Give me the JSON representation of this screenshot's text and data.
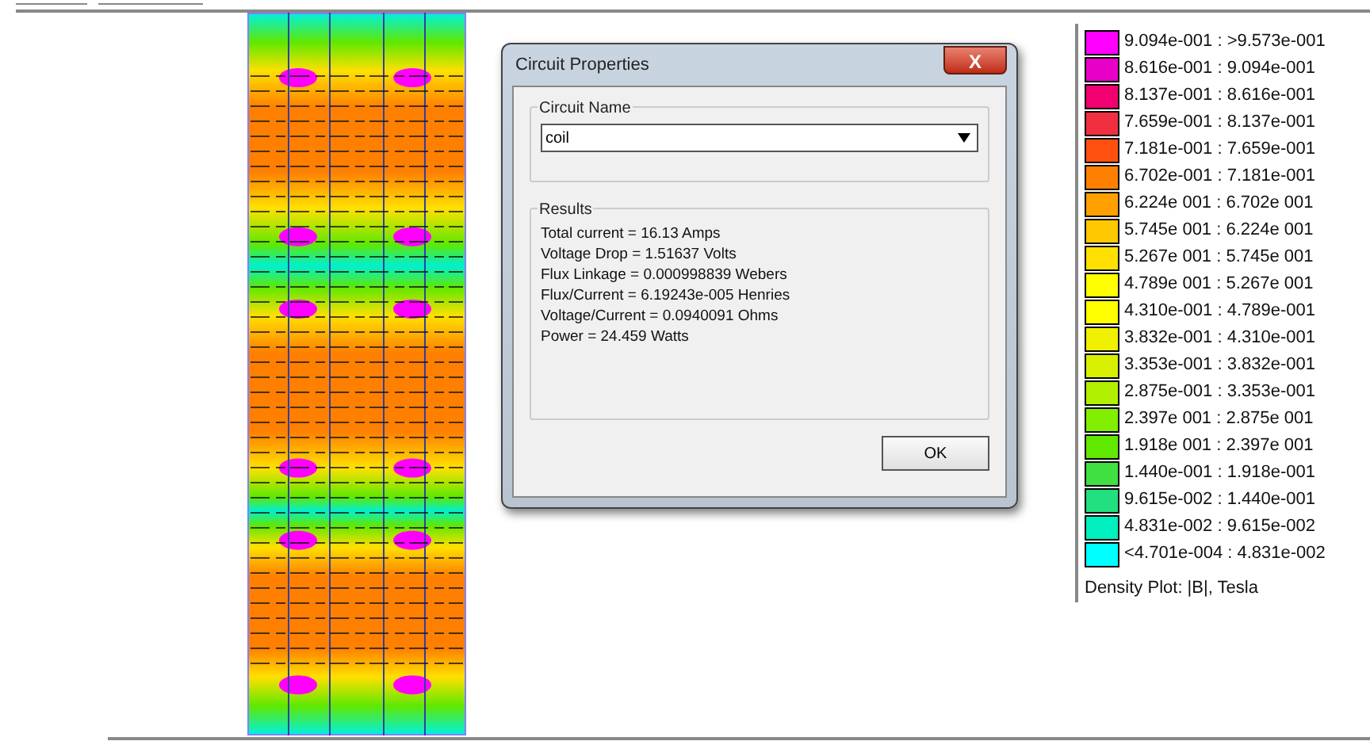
{
  "dialog": {
    "title": "Circuit Properties",
    "close": "X",
    "circuit_name": {
      "label": "Circuit Name",
      "value": "coil"
    },
    "results": {
      "label": "Results",
      "lines": [
        "Total current = 16.13 Amps",
        "Voltage Drop = 1.51637 Volts",
        "Flux Linkage = 0.000998839 Webers",
        "Flux/Current = 6.19243e-005 Henries",
        "Voltage/Current = 0.0940091 Ohms",
        "Power = 24.459 Watts"
      ]
    },
    "ok_button": "OK"
  },
  "legend": {
    "entries": [
      {
        "range": "9.094e-001 : >9.573e-001",
        "color": "#ff00ff"
      },
      {
        "range": "8.616e-001 : 9.094e-001",
        "color": "#e800c8"
      },
      {
        "range": "8.137e-001 : 8.616e-001",
        "color": "#f00070"
      },
      {
        "range": "7.659e-001 : 8.137e-001",
        "color": "#f03040"
      },
      {
        "range": "7.181e-001 : 7.659e-001",
        "color": "#ff5010"
      },
      {
        "range": "6.702e-001 : 7.181e-001",
        "color": "#ff8000"
      },
      {
        "range": "6.224e 001 : 6.702e 001",
        "color": "#ffa000"
      },
      {
        "range": "5.745e 001 : 6.224e 001",
        "color": "#ffc800"
      },
      {
        "range": "5.267e 001 : 5.745e 001",
        "color": "#ffe000"
      },
      {
        "range": "4.789e 001 : 5.267e 001",
        "color": "#ffff00"
      },
      {
        "range": "4.310e-001 : 4.789e-001",
        "color": "#fefe00"
      },
      {
        "range": "3.832e-001 : 4.310e-001",
        "color": "#f0f000"
      },
      {
        "range": "3.353e-001 : 3.832e-001",
        "color": "#d8f000"
      },
      {
        "range": "2.875e-001 : 3.353e-001",
        "color": "#b0f000"
      },
      {
        "range": "2.397e 001 : 2.875e 001",
        "color": "#80f000"
      },
      {
        "range": "1.918e 001 : 2.397e 001",
        "color": "#60e800"
      },
      {
        "range": "1.440e-001 : 1.918e-001",
        "color": "#40e040"
      },
      {
        "range": "9.615e-002 : 1.440e-001",
        "color": "#20e080"
      },
      {
        "range": "4.831e-002 : 9.615e-002",
        "color": "#00f0c0"
      },
      {
        "range": "<4.701e-004 : 4.831e-002",
        "color": "#00ffff"
      }
    ],
    "caption": "Density Plot: |B|, Tesla"
  }
}
